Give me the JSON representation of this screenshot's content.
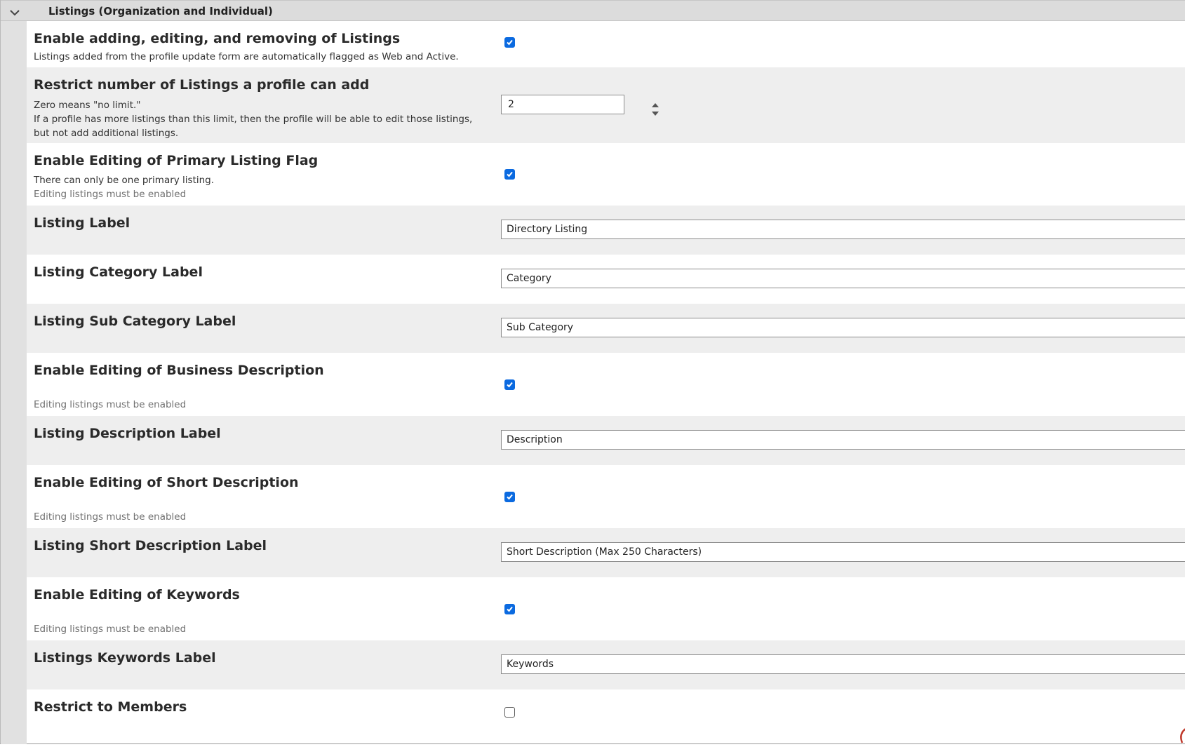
{
  "section": {
    "title": "Listings (Organization and Individual)",
    "collapse_icon": "chevron-down-icon"
  },
  "rows": {
    "enable_listings": {
      "label": "Enable adding, editing, and removing of Listings",
      "description": "Listings added from the profile update form are automatically flagged as Web and Active.",
      "checked": true
    },
    "restrict_number": {
      "label": "Restrict number of Listings a profile can add",
      "description_line1": "Zero means \"no limit.\"",
      "description_line2": "If a profile has more listings than this limit, then the profile will be able to edit those listings, but not add additional listings.",
      "value": "2"
    },
    "primary_flag": {
      "label": "Enable Editing of Primary Listing Flag",
      "description": "There can only be one primary listing.",
      "note": "Editing listings must be enabled",
      "checked": true
    },
    "listing_label": {
      "label": "Listing Label",
      "value": "Directory Listing"
    },
    "category_label": {
      "label": "Listing Category Label",
      "value": "Category"
    },
    "subcategory_label": {
      "label": "Listing Sub Category Label",
      "value": "Sub Category"
    },
    "business_description": {
      "label": "Enable Editing of Business Description",
      "note": "Editing listings must be enabled",
      "checked": true
    },
    "description_label": {
      "label": "Listing Description Label",
      "value": "Description"
    },
    "short_description": {
      "label": "Enable Editing of Short Description",
      "note": "Editing listings must be enabled",
      "checked": true
    },
    "short_description_label": {
      "label": "Listing Short Description Label",
      "value": "Short Description (Max 250 Characters)"
    },
    "keywords": {
      "label": "Enable Editing of Keywords",
      "note": "Editing listings must be enabled",
      "checked": true
    },
    "keywords_label": {
      "label": "Listings Keywords Label",
      "value": "Keywords"
    },
    "restrict_members": {
      "label": "Restrict to Members",
      "checked": false
    }
  },
  "colors": {
    "checkbox_checked": "#0b6ae0",
    "row_alt": "#eeeeee",
    "header_bg": "#dcdcdc"
  }
}
